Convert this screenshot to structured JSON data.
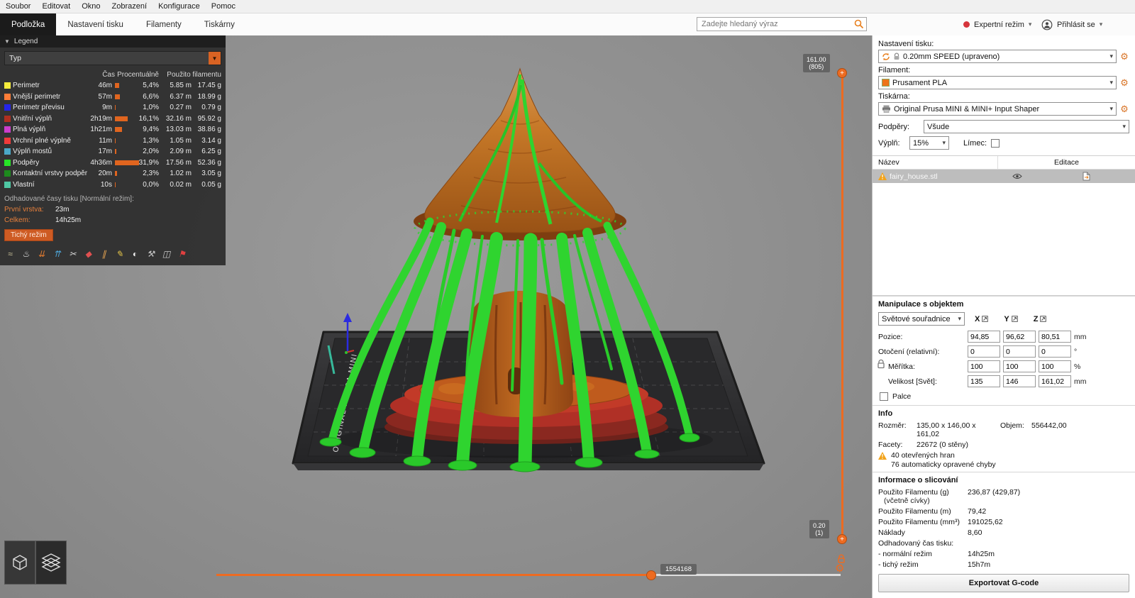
{
  "accent": "#ED6B21",
  "menubar": {
    "items": [
      "Soubor",
      "Editovat",
      "Okno",
      "Zobrazení",
      "Konfigurace",
      "Pomoc"
    ]
  },
  "tabbar": {
    "tabs": [
      {
        "label": "Podložka",
        "active": true
      },
      {
        "label": "Nastavení tisku",
        "active": false
      },
      {
        "label": "Filamenty",
        "active": false
      },
      {
        "label": "Tiskárny",
        "active": false
      }
    ],
    "search": {
      "placeholder": "Zadejte hledaný výraz"
    },
    "mode_label": "Expertní režim",
    "login_label": "Přihlásit se"
  },
  "legend": {
    "header": "Legend",
    "view_type": "Typ",
    "col_time": "Čas",
    "col_pct": "Procentuálně",
    "col_used": "Použito filamentu",
    "rows": [
      {
        "name": "Perimetr",
        "color": "#F6EC3C",
        "time": "46m",
        "pct": "5,4%",
        "pct_num": 5.4,
        "length": "5.85 m",
        "weight": "17.45 g"
      },
      {
        "name": "Vnější perimetr",
        "color": "#FF7D38",
        "time": "57m",
        "pct": "6,6%",
        "pct_num": 6.6,
        "length": "6.37 m",
        "weight": "18.99 g"
      },
      {
        "name": "Perimetr převisu",
        "color": "#2525E8",
        "time": "9m",
        "pct": "1,0%",
        "pct_num": 1.0,
        "length": "0.27 m",
        "weight": "0.79 g"
      },
      {
        "name": "Vnitřní výplň",
        "color": "#AF2F20",
        "time": "2h19m",
        "pct": "16,1%",
        "pct_num": 16.1,
        "length": "32.16 m",
        "weight": "95.92 g"
      },
      {
        "name": "Plná výplň",
        "color": "#CC3ECC",
        "time": "1h21m",
        "pct": "9,4%",
        "pct_num": 9.4,
        "length": "13.03 m",
        "weight": "38.86 g"
      },
      {
        "name": "Vrchní plné výplně",
        "color": "#F03A3A",
        "time": "11m",
        "pct": "1,3%",
        "pct_num": 1.3,
        "length": "1.05 m",
        "weight": "3.14 g"
      },
      {
        "name": "Výplň mostů",
        "color": "#4BA8C8",
        "time": "17m",
        "pct": "2,0%",
        "pct_num": 2.0,
        "length": "2.09 m",
        "weight": "6.25 g"
      },
      {
        "name": "Podpěry",
        "color": "#27E427",
        "time": "4h36m",
        "pct": "31,9%",
        "pct_num": 31.9,
        "length": "17.56 m",
        "weight": "52.36 g"
      },
      {
        "name": "Kontaktní vrstvy podpěr",
        "color": "#1D8A1D",
        "time": "20m",
        "pct": "2,3%",
        "pct_num": 2.3,
        "length": "1.02 m",
        "weight": "3.05 g"
      },
      {
        "name": "Vlastní",
        "color": "#4FC8A4",
        "time": "10s",
        "pct": "0,0%",
        "pct_num": 0.3,
        "length": "0.02 m",
        "weight": "0.05 g"
      }
    ],
    "estimate_title": "Odhadované časy tisku [Normální režim]:",
    "first_layer_label": "První vrstva:",
    "first_layer_value": "23m",
    "total_label": "Celkem:",
    "total_value": "14h25m",
    "quiet_mode_button": "Tichý režim",
    "tools": [
      {
        "name": "travels-icon",
        "glyph": "≈",
        "color": "#CDC49B"
      },
      {
        "name": "wipe-icon",
        "glyph": "♨",
        "color": "#E6E6E6"
      },
      {
        "name": "retractions-icon",
        "glyph": "⇊",
        "color": "#E07A30"
      },
      {
        "name": "deretractions-icon",
        "glyph": "⇈",
        "color": "#4FA6D8"
      },
      {
        "name": "seams-icon",
        "glyph": "✂",
        "color": "#D8D8D8"
      },
      {
        "name": "color-changes-icon",
        "glyph": "◆",
        "color": "#E05050"
      },
      {
        "name": "pause-prints-icon",
        "glyph": "∥",
        "color": "#E0A050"
      },
      {
        "name": "custom-gcode-icon",
        "glyph": "✎",
        "color": "#E8C84A"
      },
      {
        "name": "shells-icon",
        "glyph": "◐",
        "color": "#F0F0F0"
      },
      {
        "name": "tool-changes-icon",
        "glyph": "⚒",
        "color": "#C8C8C8"
      },
      {
        "name": "box-icon",
        "glyph": "◫",
        "color": "#CCCCCC"
      },
      {
        "name": "legend-pin-icon",
        "glyph": "⚑",
        "color": "#E04040"
      }
    ]
  },
  "viewport": {
    "bed_label": "ORIGINAL PRUSA MINI",
    "layer_slider": {
      "top_value": "161.00",
      "top_layer": "(805)",
      "bottom_value": "0.20",
      "bottom_layer": "(1)"
    },
    "move_slider": {
      "value": "1554168"
    }
  },
  "sidebar": {
    "print_settings": {
      "label": "Nastavení tisku:",
      "value": "0.20mm SPEED (upraveno)"
    },
    "filament": {
      "label": "Filament:",
      "value": "Prusament PLA",
      "color": "#EE7219"
    },
    "printer": {
      "label": "Tiskárna:",
      "value": "Original Prusa MINI & MINI+ Input Shaper"
    },
    "supports": {
      "label": "Podpěry:",
      "value": "Všude"
    },
    "infill": {
      "label": "Výplň:",
      "value": "15%"
    },
    "brim": {
      "label": "Límec:"
    },
    "object_list": {
      "col_name": "Název",
      "col_edit": "Editace",
      "rows": [
        {
          "name": "fairy_house.stl"
        }
      ]
    },
    "manipulation": {
      "title": "Manipulace s objektem",
      "coords": "Světové souřadnice",
      "axes": [
        "X",
        "Y",
        "Z"
      ],
      "rows": [
        {
          "label": "Pozice:",
          "x": "94,85",
          "y": "96,62",
          "z": "80,51",
          "unit": "mm",
          "indent": false
        },
        {
          "label": "Otočení (relativní):",
          "x": "0",
          "y": "0",
          "z": "0",
          "unit": "°",
          "indent": false
        },
        {
          "label": "Měřítka:",
          "x": "100",
          "y": "100",
          "z": "100",
          "unit": "%",
          "indent": true
        },
        {
          "label": "Velikost [Svět]:",
          "x": "135",
          "y": "146",
          "z": "161,02",
          "unit": "mm",
          "indent": true
        }
      ],
      "inches_label": "Palce"
    },
    "info": {
      "title": "Info",
      "size_label": "Rozměr:",
      "size_value": "135,00 x 146,00 x 161,02",
      "volume_label": "Objem:",
      "volume_value": "556442,00",
      "facets_label": "Facety:",
      "facets_value": "22672 (0 stěny)",
      "warning_line1": "40 otevřených hran",
      "warning_line2": "76 automaticky opravené chyby"
    },
    "sliced_info": {
      "title": "Informace o slicování",
      "rows": [
        {
          "label": "Použito Filamentu (g)",
          "sub": "(včetně cívky)",
          "value": "236,87 (429,87)"
        },
        {
          "label": "Použito Filamentu (m)",
          "value": "79,42"
        },
        {
          "label": "Použito Filamentu (mm³)",
          "value": "191025,62"
        },
        {
          "label": "Náklady",
          "value": "8,60"
        },
        {
          "label": "Odhadovaný čas tisku:",
          "value": ""
        },
        {
          "label": "- normální režim",
          "value": "14h25m"
        },
        {
          "label": "- tichý režim",
          "value": "15h7m"
        }
      ]
    },
    "export_button": "Exportovat G-code"
  }
}
